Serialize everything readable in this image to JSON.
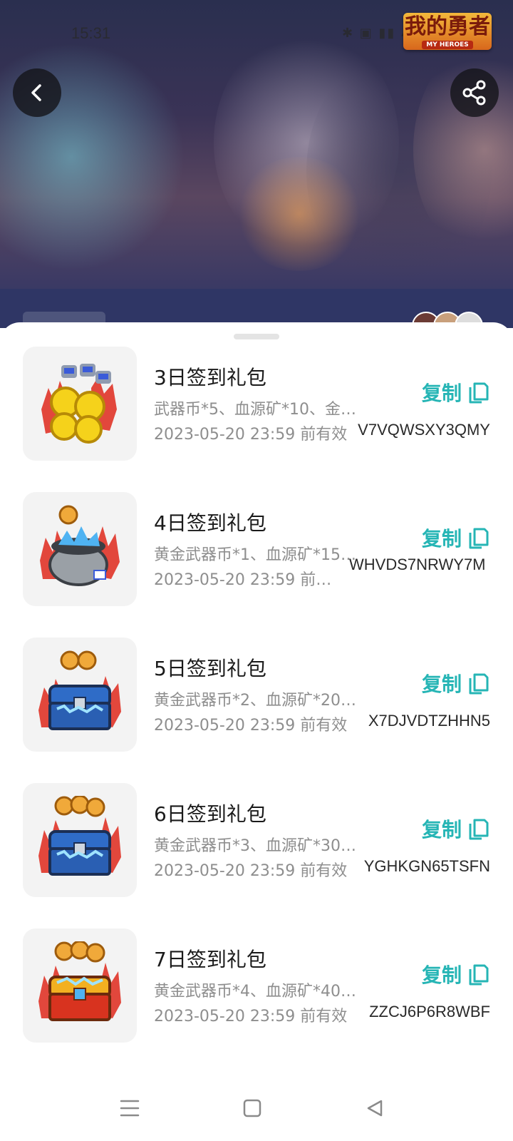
{
  "status_bar": {
    "time": "15:31",
    "icons_text": "✱ ▣ ▮▮ ▰▰"
  },
  "game_logo": {
    "title": "我的勇者",
    "subtitle": "MY HEROES"
  },
  "header": {
    "back_icon": "chevron-left-icon",
    "share_icon": "share-icon"
  },
  "accent_color": "#26b5b5",
  "gifts": [
    {
      "title": "3日签到礼包",
      "desc": "武器币*5、血源矿*10、金…",
      "expiry": "2023-05-20 23:59 前有效",
      "code": "V7VQWSXY3QMY",
      "copy_label": "复制",
      "chest": "coins"
    },
    {
      "title": "4日签到礼包",
      "desc": "黄金武器币*1、血源矿*15…",
      "expiry": "2023-05-20 23:59 前有…",
      "code": "WHVDS7NRWY7M",
      "copy_label": "复制",
      "chest": "pot"
    },
    {
      "title": "5日签到礼包",
      "desc": "黄金武器币*2、血源矿*20…",
      "expiry": "2023-05-20 23:59 前有效",
      "code": "X7DJVDTZHHN5",
      "copy_label": "复制",
      "chest": "blue-chest"
    },
    {
      "title": "6日签到礼包",
      "desc": "黄金武器币*3、血源矿*30…",
      "expiry": "2023-05-20 23:59 前有效",
      "code": "YGHKGN65TSFN",
      "copy_label": "复制",
      "chest": "blue-chest"
    },
    {
      "title": "7日签到礼包",
      "desc": "黄金武器币*4、血源矿*40…",
      "expiry": "2023-05-20 23:59 前有效",
      "code": "ZZCJ6P6R8WBF",
      "copy_label": "复制",
      "chest": "red-chest"
    }
  ],
  "nav": {
    "menu_icon": "menu-icon",
    "home_icon": "home-square-icon",
    "back_icon": "back-triangle-icon"
  }
}
